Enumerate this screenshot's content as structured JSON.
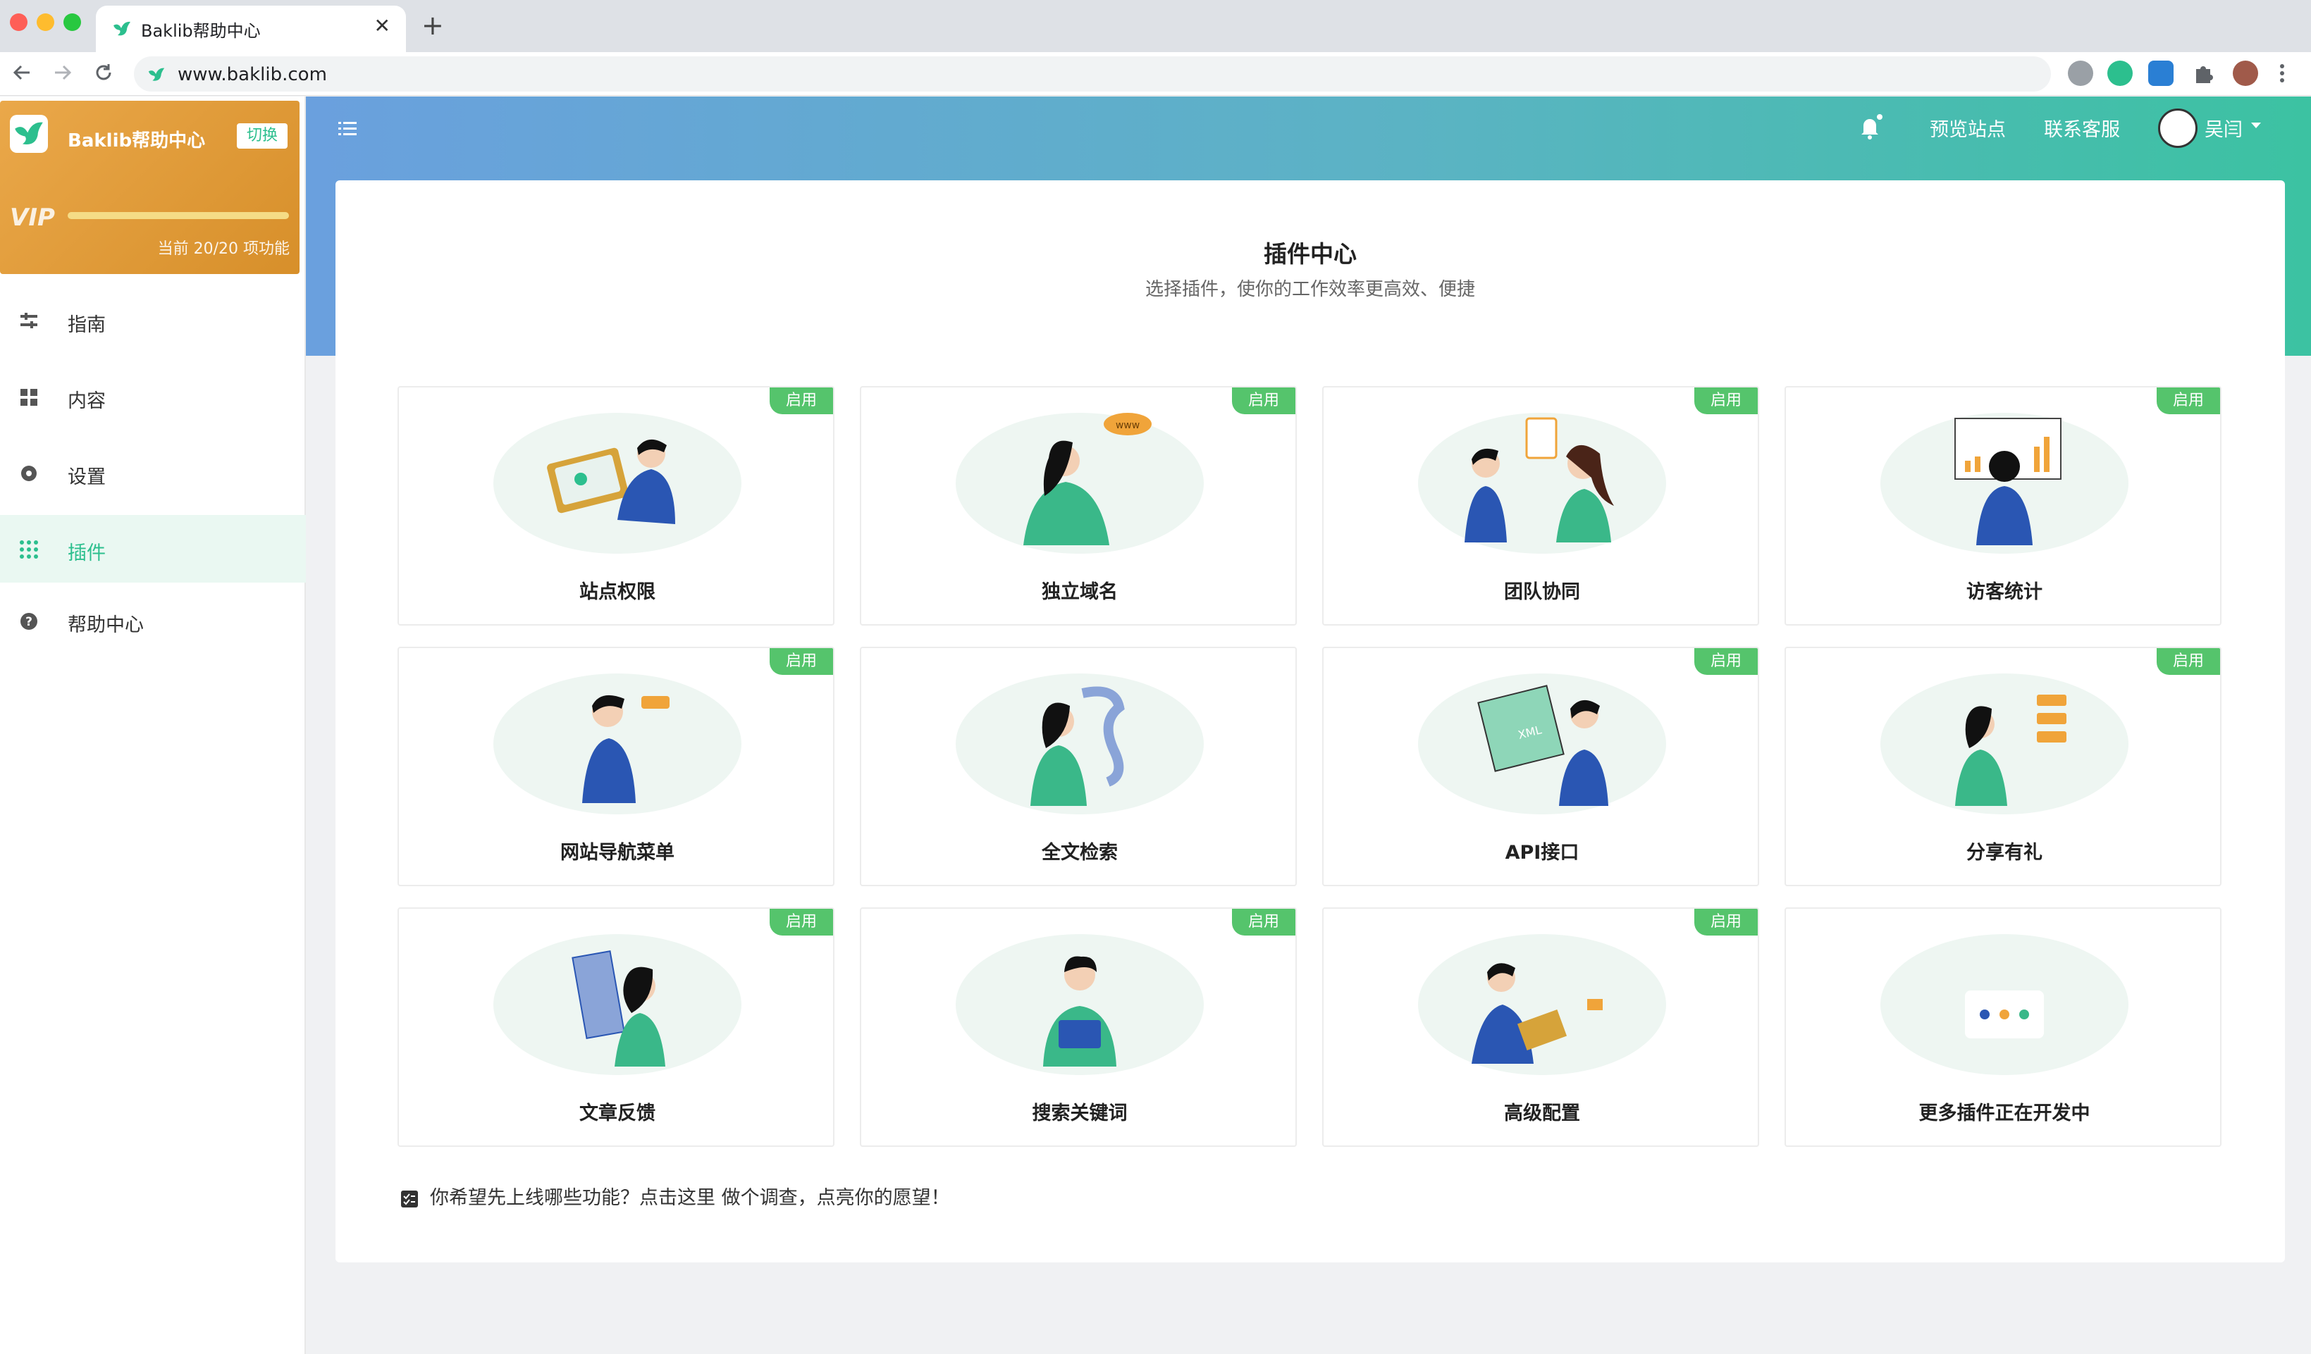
{
  "browser": {
    "tab_title": "Baklib帮助中心",
    "tab_close": "✕",
    "new_tab": "+",
    "url": "www.baklib.com"
  },
  "sidebar": {
    "site_name": "Baklib帮助中心",
    "switch_label": "切换",
    "vip_label": "VIP",
    "feature_count": "当前 20/20 项功能",
    "feature_progress": 1.0,
    "items": [
      {
        "label": "指南",
        "icon": "sliders-icon",
        "active": false
      },
      {
        "label": "内容",
        "icon": "grid-icon",
        "active": false
      },
      {
        "label": "设置",
        "icon": "gear-icon",
        "active": false
      },
      {
        "label": "插件",
        "icon": "apps-icon",
        "active": true
      },
      {
        "label": "帮助中心",
        "icon": "help-icon",
        "active": false
      }
    ]
  },
  "header": {
    "preview": "预览站点",
    "contact": "联系客服",
    "user": "吴闫"
  },
  "main": {
    "title": "插件中心",
    "subtitle": "选择插件，使你的工作效率更高效、便捷",
    "plugins": [
      {
        "name": "站点权限",
        "badge": "启用"
      },
      {
        "name": "独立域名",
        "badge": "启用"
      },
      {
        "name": "团队协同",
        "badge": "启用"
      },
      {
        "name": "访客统计",
        "badge": "启用"
      },
      {
        "name": "网站导航菜单",
        "badge": "启用"
      },
      {
        "name": "全文检索",
        "badge": ""
      },
      {
        "name": "API接口",
        "badge": "启用"
      },
      {
        "name": "分享有礼",
        "badge": "启用"
      },
      {
        "name": "文章反馈",
        "badge": "启用"
      },
      {
        "name": "搜索关键词",
        "badge": "启用"
      },
      {
        "name": "高级配置",
        "badge": "启用"
      },
      {
        "name": "更多插件正在开发中",
        "badge": ""
      }
    ],
    "survey_text": "你希望先上线哪些功能？点击这里 做个调查，点亮你的愿望！"
  },
  "colors": {
    "accent": "#2cbf8e",
    "badge": "#55c46c",
    "vip_card": "#e3a03d"
  }
}
